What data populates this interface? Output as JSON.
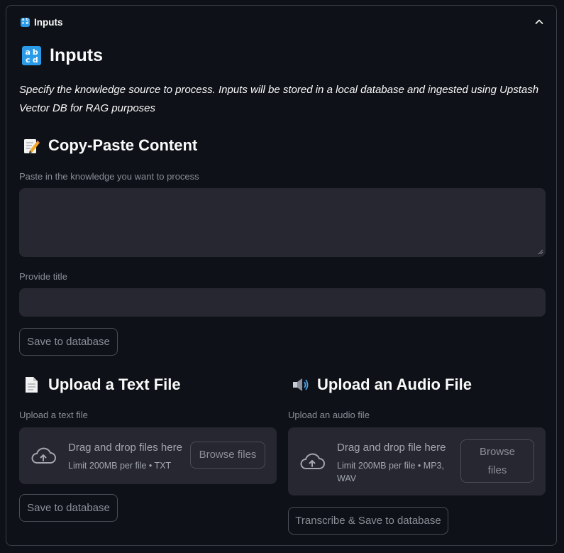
{
  "expander": {
    "title": "Inputs",
    "icon": "abcd-input-icon",
    "state": "expanded"
  },
  "header": {
    "title": "Inputs",
    "description": "Specify the knowledge source to process. Inputs will be stored in a local database and ingested using Upstash Vector DB for RAG purposes"
  },
  "copy_paste": {
    "heading": "Copy-Paste Content",
    "icon": "memo-icon",
    "textarea_label": "Paste in the knowledge you want to process",
    "textarea_value": "",
    "title_label": "Provide title",
    "title_value": "",
    "save_label": "Save to database"
  },
  "text_upload": {
    "heading": "Upload a Text File",
    "icon": "page-icon",
    "label": "Upload a text file",
    "drop_text": "Drag and drop files here",
    "limit_text": "Limit 200MB per file • TXT",
    "browse_label": "Browse files",
    "save_label": "Save to database"
  },
  "audio_upload": {
    "heading": "Upload an Audio File",
    "icon": "speaker-icon",
    "label": "Upload an audio file",
    "drop_text": "Drag and drop file here",
    "limit_text": "Limit 200MB per file • MP3, WAV",
    "browse_label": "Browse files",
    "save_label": "Transcribe & Save to database"
  },
  "colors": {
    "background": "#0e1117",
    "widget_bg": "#262730",
    "border": "#3a3d47",
    "muted_text": "#8b8e98",
    "accent_icon": "#2b9be8"
  }
}
